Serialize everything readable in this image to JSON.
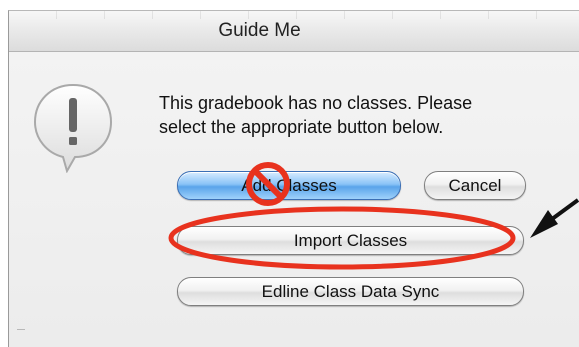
{
  "window": {
    "title": "Guide Me"
  },
  "dialog": {
    "icon": "alert-icon",
    "message_line1": "This gradebook has no classes. Please",
    "message_line2": "select the appropriate button below."
  },
  "buttons": {
    "add_classes": "Add Classes",
    "cancel": "Cancel",
    "import_classes": "Import Classes",
    "edline_sync": "Edline Class Data Sync"
  },
  "annotations": {
    "no_symbol_icon": "prohibited-icon",
    "highlight": "red-ellipse",
    "pointer": "arrow-icon",
    "annotation_color": "#e8321e",
    "arrow_color": "#111111"
  }
}
